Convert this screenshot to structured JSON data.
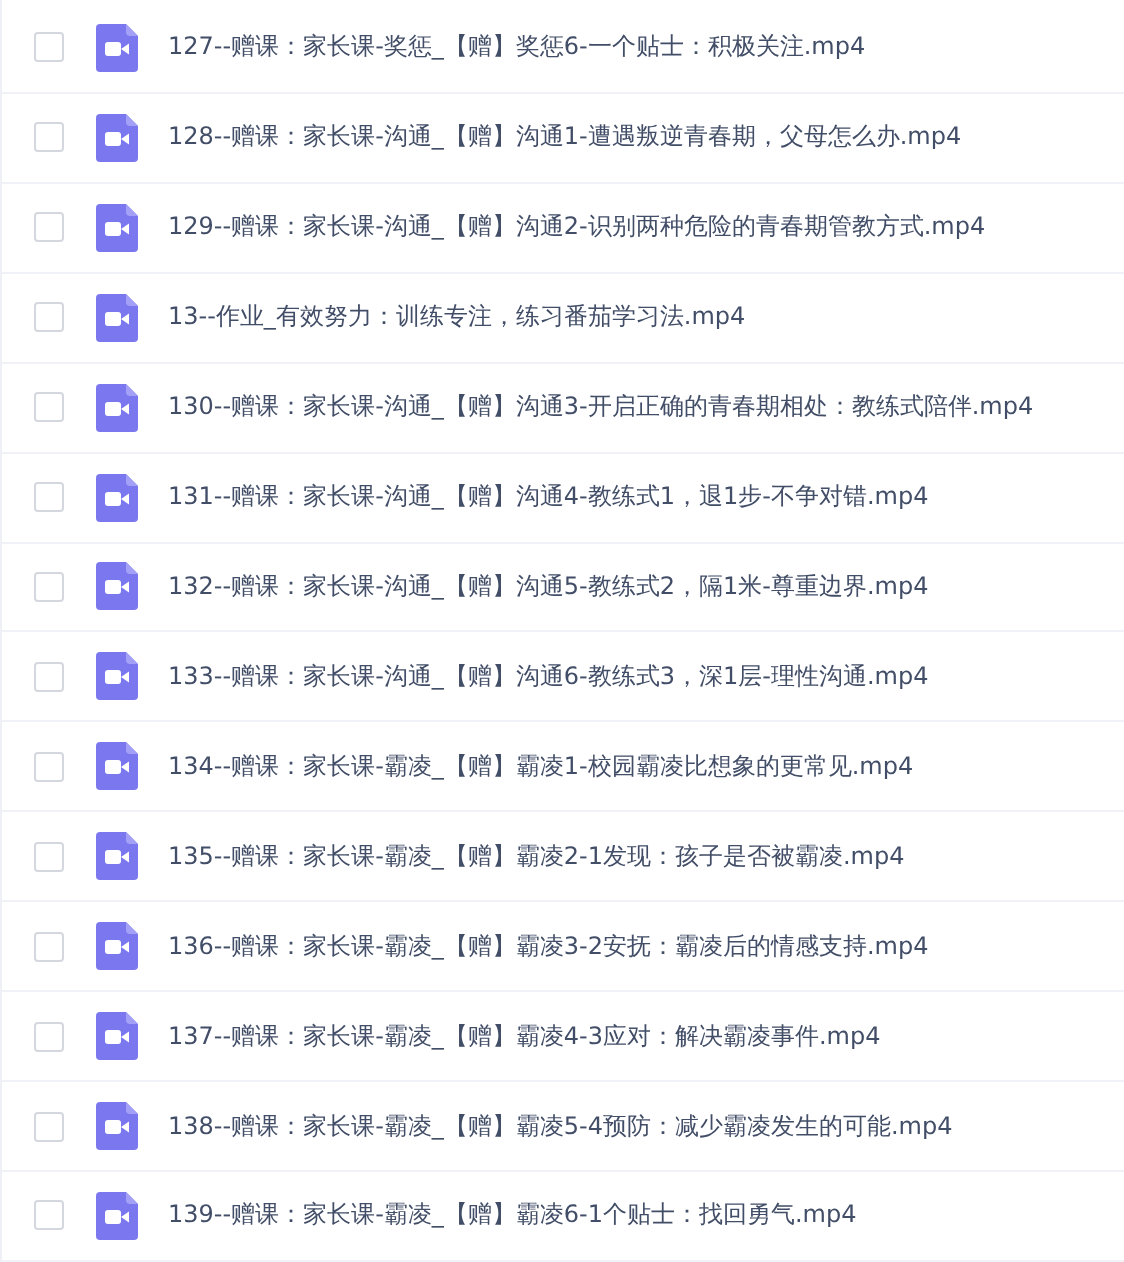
{
  "files": [
    {
      "name": "127--赠课：家长课-奖惩_【赠】奖惩6-一个贴士：积极关注.mp4",
      "checked": false
    },
    {
      "name": "128--赠课：家长课-沟通_【赠】沟通1-遭遇叛逆青春期，父母怎么办.mp4",
      "checked": false
    },
    {
      "name": "129--赠课：家长课-沟通_【赠】沟通2-识别两种危险的青春期管教方式.mp4",
      "checked": false
    },
    {
      "name": "13--作业_有效努力：训练专注，练习番茄学习法.mp4",
      "checked": false
    },
    {
      "name": "130--赠课：家长课-沟通_【赠】沟通3-开启正确的青春期相处：教练式陪伴.mp4",
      "checked": false
    },
    {
      "name": "131--赠课：家长课-沟通_【赠】沟通4-教练式1，退1步-不争对错.mp4",
      "checked": false
    },
    {
      "name": "132--赠课：家长课-沟通_【赠】沟通5-教练式2，隔1米-尊重边界.mp4",
      "checked": false
    },
    {
      "name": "133--赠课：家长课-沟通_【赠】沟通6-教练式3，深1层-理性沟通.mp4",
      "checked": false
    },
    {
      "name": "134--赠课：家长课-霸凌_【赠】霸凌1-校园霸凌比想象的更常见.mp4",
      "checked": false
    },
    {
      "name": "135--赠课：家长课-霸凌_【赠】霸凌2-1发现：孩子是否被霸凌.mp4",
      "checked": false
    },
    {
      "name": "136--赠课：家长课-霸凌_【赠】霸凌3-2安抚：霸凌后的情感支持.mp4",
      "checked": false
    },
    {
      "name": "137--赠课：家长课-霸凌_【赠】霸凌4-3应对：解决霸凌事件.mp4",
      "checked": false
    },
    {
      "name": "138--赠课：家长课-霸凌_【赠】霸凌5-4预防：减少霸凌发生的可能.mp4",
      "checked": false
    },
    {
      "name": "139--赠课：家长课-霸凌_【赠】霸凌6-1个贴士：找回勇气.mp4",
      "checked": false
    }
  ]
}
